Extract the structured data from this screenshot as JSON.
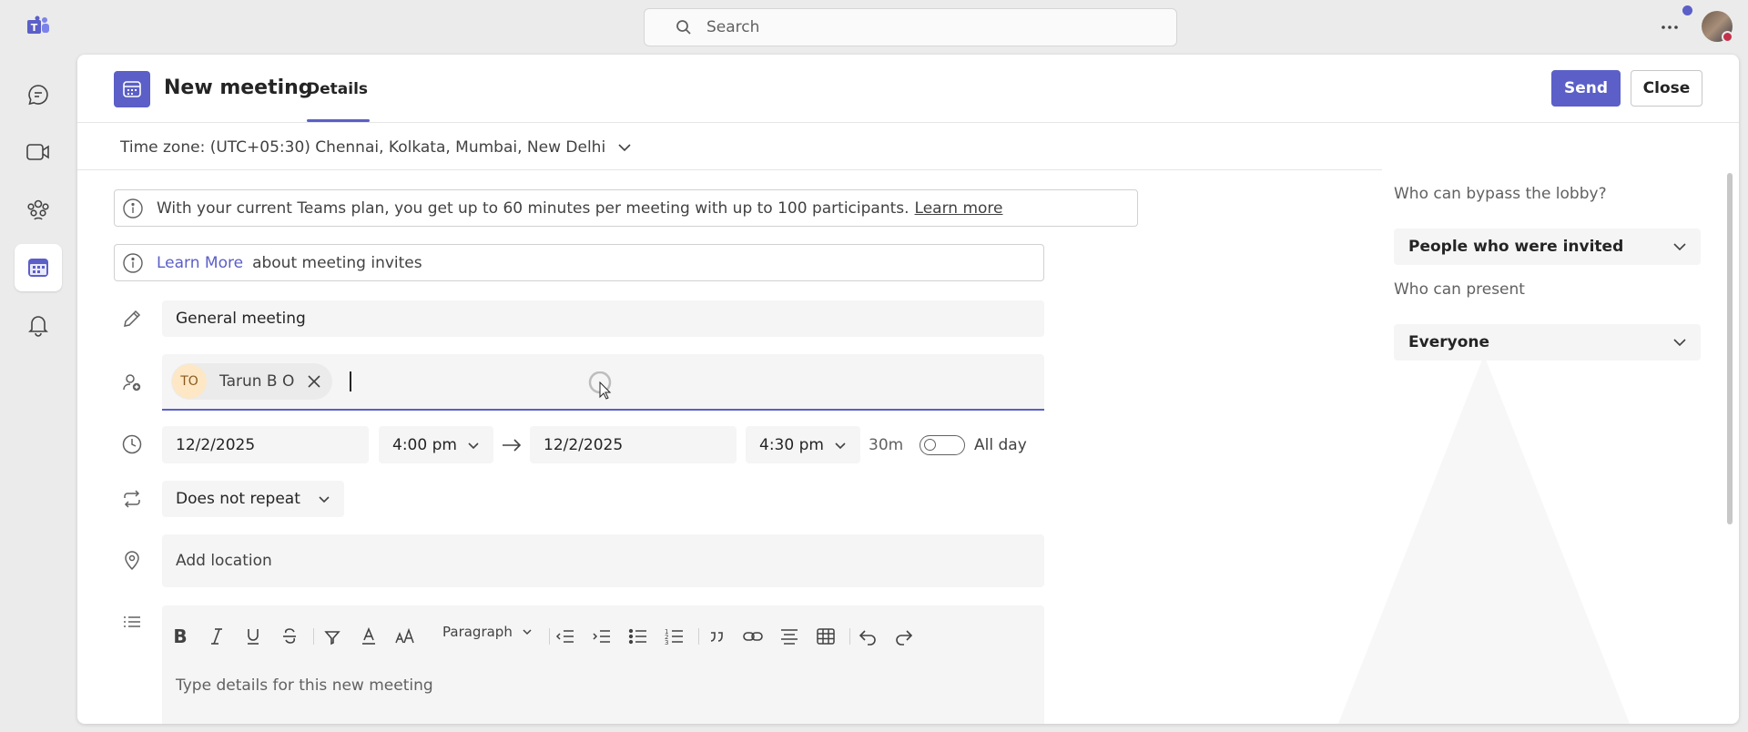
{
  "search": {
    "placeholder": "Search"
  },
  "meeting": {
    "title": "New meeting",
    "tab_details": "Details",
    "send_label": "Send",
    "close_label": "Close",
    "timezone": "Time zone: (UTC+05:30) Chennai, Kolkata, Mumbai, New Delhi",
    "plan_banner": {
      "text": "With your current Teams plan, you get up to 60 minutes per meeting with up to 100 participants.",
      "link": "Learn more"
    },
    "invite_banner": {
      "link": "Learn More",
      "text": "about meeting invites"
    },
    "title_value": "General meeting",
    "attendee": {
      "initials": "TO",
      "name": "Tarun B O"
    },
    "start_date": "12/2/2025",
    "start_time": "4:00 pm",
    "end_date": "12/2/2025",
    "end_time": "4:30 pm",
    "duration": "30m",
    "all_day_label": "All day",
    "all_day_on": false,
    "repeat": "Does not repeat",
    "location_placeholder": "Add location",
    "editor": {
      "paragraph_label": "Paragraph",
      "placeholder": "Type details for this new meeting"
    }
  },
  "options": {
    "bypass_label": "Who can bypass the lobby?",
    "bypass_value": "People who were invited",
    "present_label": "Who can present",
    "present_value": "Everyone"
  },
  "colors": {
    "accent": "#5b5fc7",
    "avatar_bg": "#fde7c5"
  }
}
